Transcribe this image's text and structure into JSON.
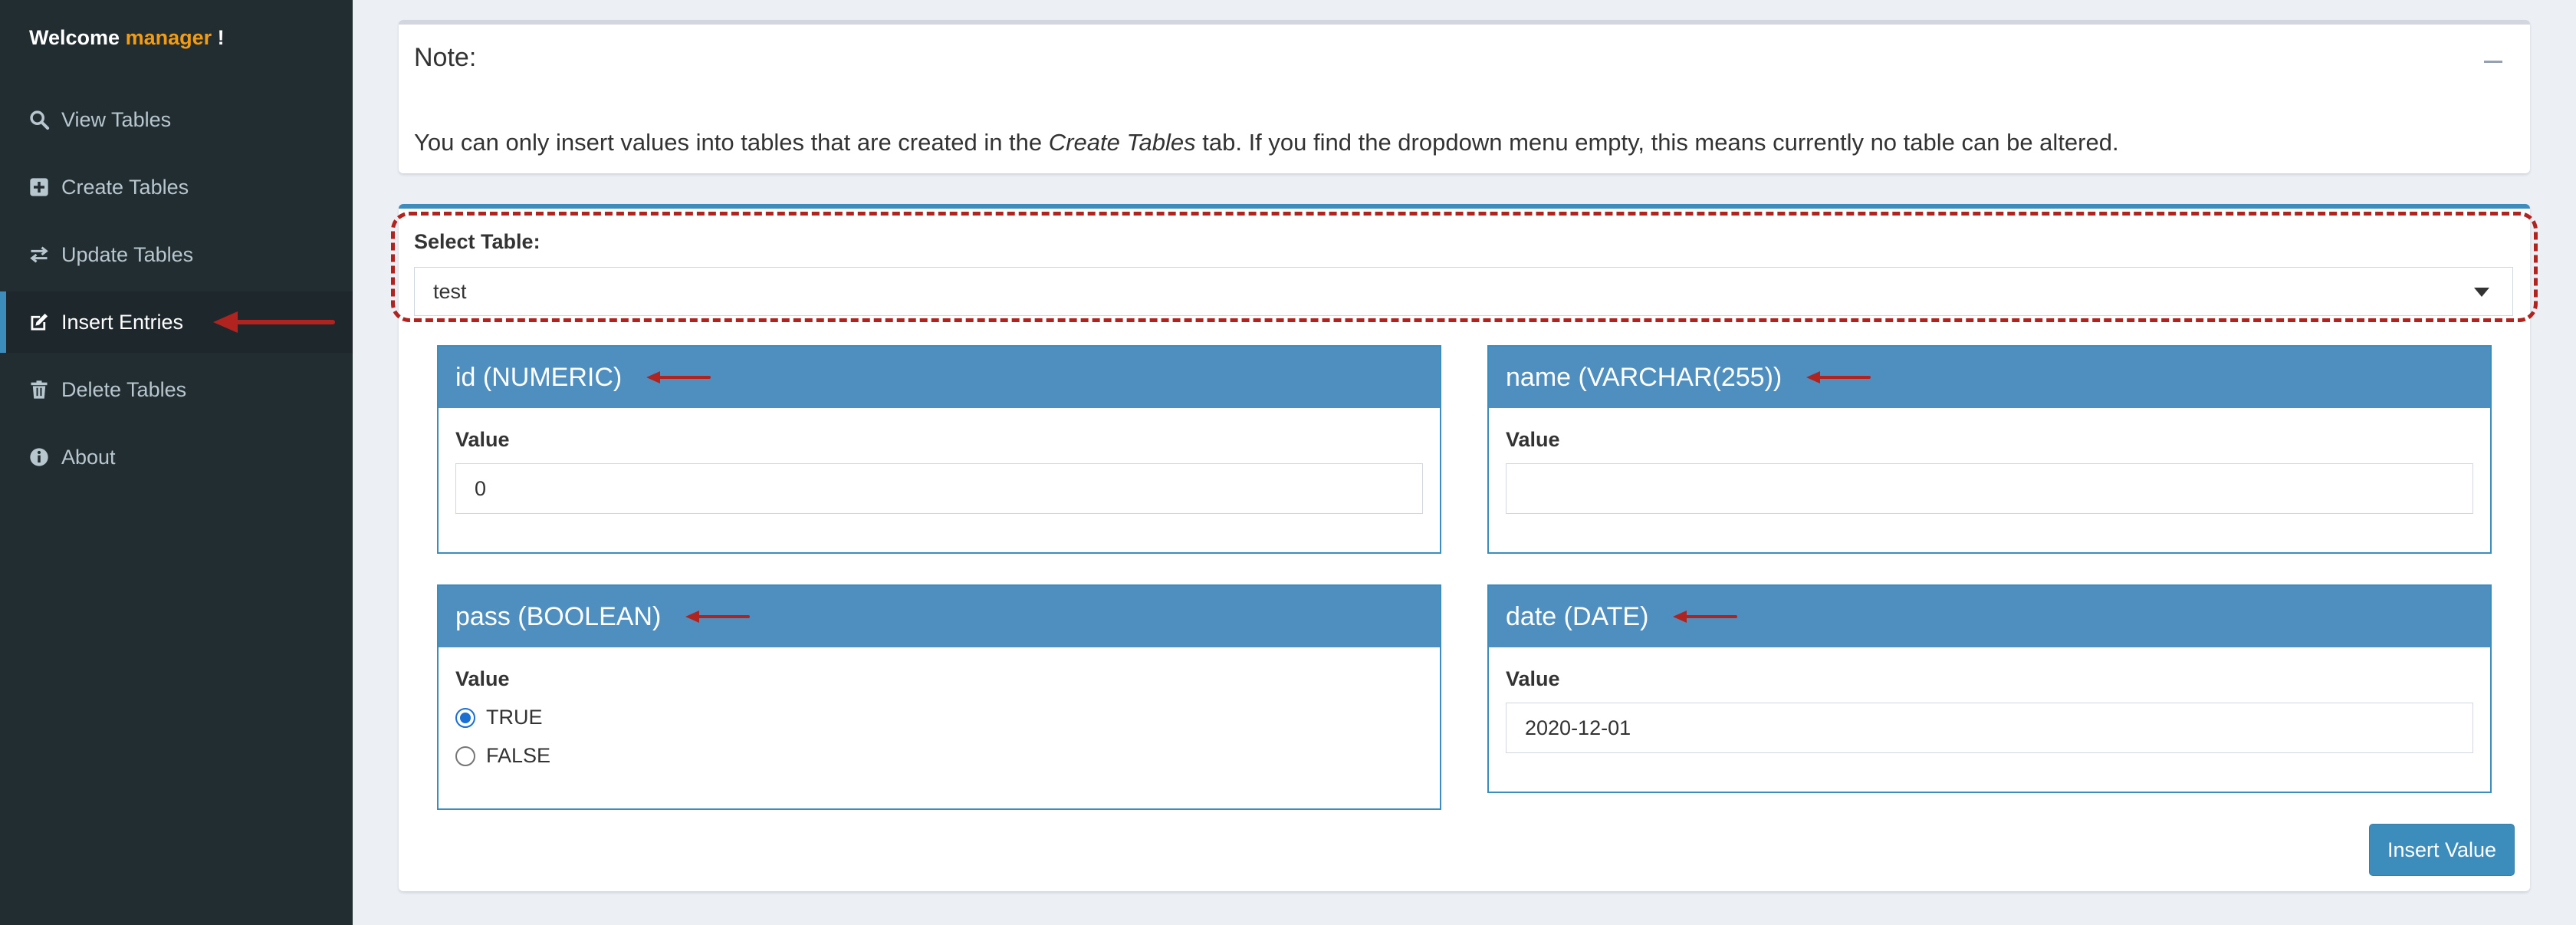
{
  "sidebar": {
    "welcome_prefix": "Welcome",
    "username": "manager",
    "welcome_suffix": "!",
    "items": [
      {
        "label": "View Tables",
        "icon": "search-icon"
      },
      {
        "label": "Create Tables",
        "icon": "plus-square-icon"
      },
      {
        "label": "Update Tables",
        "icon": "exchange-icon"
      },
      {
        "label": "Insert Entries",
        "icon": "edit-icon",
        "active": true
      },
      {
        "label": "Delete Tables",
        "icon": "trash-icon"
      },
      {
        "label": "About",
        "icon": "info-icon"
      }
    ]
  },
  "note": {
    "title": "Note:",
    "text_before": "You can only insert values into tables that are created in the ",
    "text_em": "Create Tables",
    "text_after": " tab. If you find the dropdown menu empty, this means currently no table can be altered."
  },
  "form": {
    "select_label": "Select Table:",
    "selected_table": "test",
    "fields": [
      {
        "title": "id (NUMERIC)",
        "value_label": "Value",
        "value": "0"
      },
      {
        "title": "name (VARCHAR(255))",
        "value_label": "Value",
        "value": ""
      },
      {
        "title": "pass (BOOLEAN)",
        "value_label": "Value",
        "options": [
          "TRUE",
          "FALSE"
        ],
        "selected": "TRUE"
      },
      {
        "title": "date (DATE)",
        "value_label": "Value",
        "value": "2020-12-01"
      }
    ],
    "submit_label": "Insert Value"
  },
  "colors": {
    "sidebar_bg": "#222d32",
    "accent": "#3c8dbc",
    "field_header": "#4f8fc0",
    "username": "#f39c12",
    "annotation": "#b0231f"
  }
}
